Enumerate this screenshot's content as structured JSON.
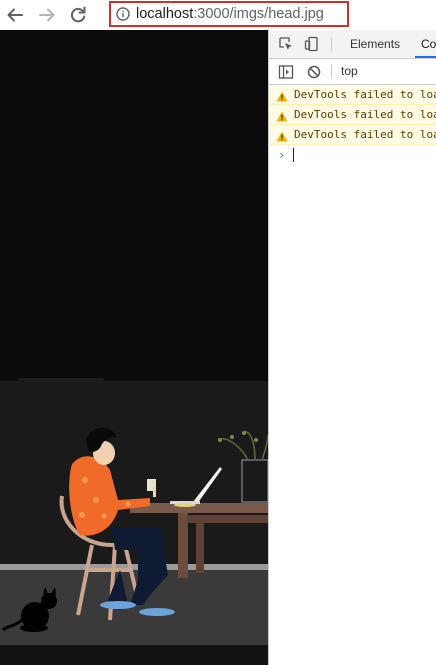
{
  "browser": {
    "url_host": "localhost",
    "url_rest": ":3000/imgs/head.jpg",
    "icons": {
      "back": "back-arrow-icon",
      "forward": "forward-arrow-icon",
      "reload": "reload-icon",
      "info": "info-icon"
    },
    "address_highlight_color": "#c9322d"
  },
  "devtools": {
    "tabs": [
      {
        "label": "Elements"
      },
      {
        "label": "Co"
      }
    ],
    "context": "top",
    "messages": [
      {
        "text": "DevTools failed to loa"
      },
      {
        "text": "DevTools failed to loa"
      },
      {
        "text": "DevTools failed to loa"
      }
    ],
    "prompt_symbol": "›",
    "colors": {
      "warning_bg": "#fffbe5",
      "warning_text": "#5c3b00",
      "accent": "#1a73e8"
    }
  }
}
